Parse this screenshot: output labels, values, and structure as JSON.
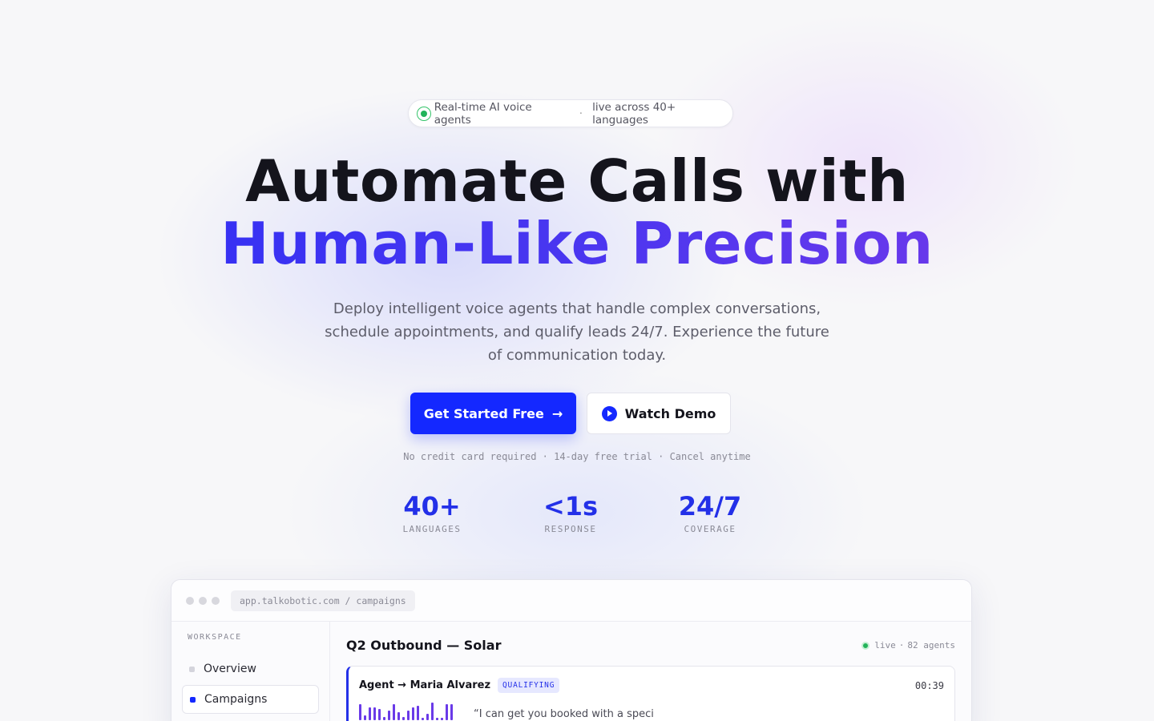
{
  "badge": {
    "text": "Real-time AI voice agents",
    "separator": "·",
    "suffix": "live across 40+ languages"
  },
  "headline": {
    "line1": "Automate Calls with",
    "line2": "Human-Like Precision"
  },
  "subheadline": "Deploy intelligent voice agents that handle complex conversations, schedule appointments, and qualify leads 24/7. Experience the future of communication today.",
  "cta": {
    "primary": "Get Started Free",
    "primary_arrow": "→",
    "secondary": "Watch Demo"
  },
  "fineprint": "No credit card required · 14-day free trial · Cancel anytime",
  "stats": [
    {
      "value": "40+",
      "label": "LANGUAGES"
    },
    {
      "value": "<1s",
      "label": "RESPONSE"
    },
    {
      "value": "24/7",
      "label": "COVERAGE"
    }
  ],
  "app_preview": {
    "url": "app.talkobotic.com / campaigns",
    "sidebar": {
      "section_label": "WORKSPACE",
      "items": [
        {
          "label": "Overview",
          "active": false
        },
        {
          "label": "Campaigns",
          "active": true
        }
      ]
    },
    "campaign": {
      "title": "Q2 Outbound — Solar",
      "status": "live",
      "separator": "·",
      "agents": "82 agents"
    },
    "call": {
      "participants": "Agent → Maria Alvarez",
      "stage": "QUALIFYING",
      "timer": "00:39",
      "transcript": "“I can get you booked with a speci"
    }
  },
  "colors": {
    "primary": "#1428ff",
    "accent": "#2330e8",
    "gradient_end": "#7a3ae8",
    "live_green": "#22b35a"
  }
}
